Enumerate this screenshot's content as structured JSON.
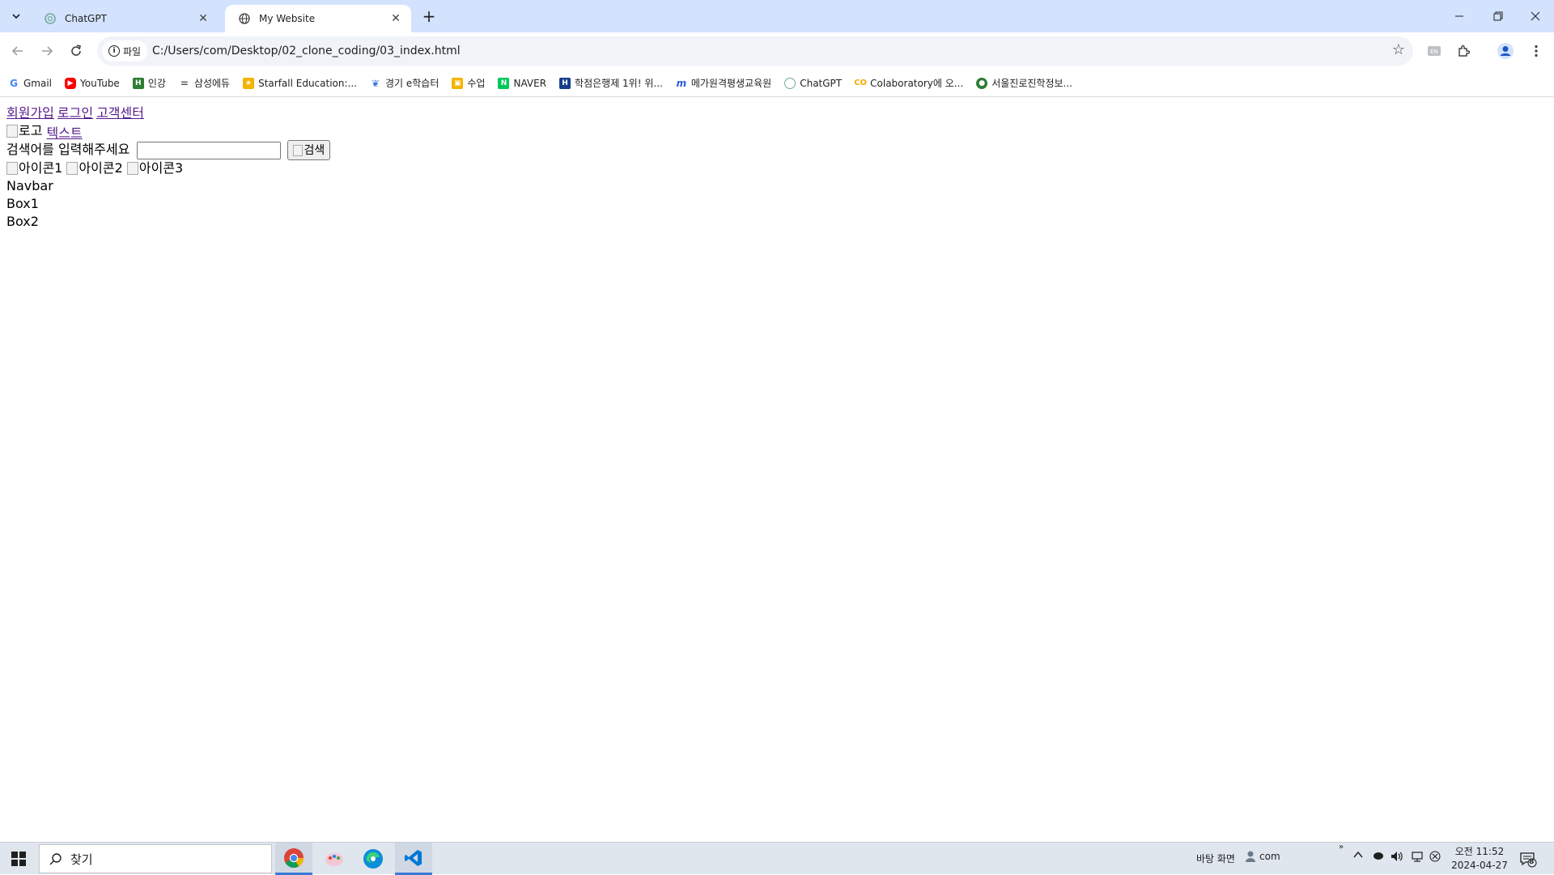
{
  "tabs": [
    {
      "title": "ChatGPT",
      "active": false,
      "icon": "chatgpt-icon"
    },
    {
      "title": "My Website",
      "active": true,
      "icon": "globe-icon"
    }
  ],
  "toolbar": {
    "site_info_label": "파일",
    "url": "C:/Users/com/Desktop/02_clone_coding/03_index.html"
  },
  "bookmarks": [
    {
      "label": "Gmail",
      "icon": "google-icon",
      "color": "#4285f4"
    },
    {
      "label": "YouTube",
      "icon": "youtube-icon",
      "color": "#ff0000"
    },
    {
      "label": "인강",
      "icon": "h-icon",
      "color": "#2e7d32"
    },
    {
      "label": "삼성에듀",
      "icon": "dash-icon",
      "color": "#555555"
    },
    {
      "label": "Starfall Education:...",
      "icon": "star-icon",
      "color": "#f4b400"
    },
    {
      "label": "경기 e학습터",
      "icon": "leaf-icon",
      "color": "#3b7dd8"
    },
    {
      "label": "수업",
      "icon": "classroom-icon",
      "color": "#f4b400"
    },
    {
      "label": "NAVER",
      "icon": "naver-icon",
      "color": "#03c75a"
    },
    {
      "label": "학점은행제 1위! 위...",
      "icon": "h-icon",
      "color": "#1a3e8c"
    },
    {
      "label": "메가원격평생교육원",
      "icon": "mega-icon",
      "color": "#2a5bd7"
    },
    {
      "label": "ChatGPT",
      "icon": "chatgpt-icon",
      "color": "#74aa9c"
    },
    {
      "label": "Colaboratory에 오...",
      "icon": "colab-icon",
      "color": "#f9ab00"
    },
    {
      "label": "서울진로진학정보...",
      "icon": "globe-icon",
      "color": "#2e7d32"
    }
  ],
  "page": {
    "nav_links": [
      "회원가입",
      "로그인",
      "고객센터"
    ],
    "logo_alt": "로고",
    "logo_text": "텍스트",
    "search_label": "검색어를 입력해주세요",
    "search_value": "",
    "search_button_alt": "검색",
    "icons": [
      "아이콘1",
      "아이콘2",
      "아이콘3"
    ],
    "navbar": "Navbar",
    "box1": "Box1",
    "box2": "Box2"
  },
  "taskbar": {
    "search_placeholder": "찾기",
    "desktop_label": "바탕 화면",
    "user_label": "com",
    "time": "오전 11:52",
    "date": "2024-04-27",
    "notification_count": "8"
  }
}
